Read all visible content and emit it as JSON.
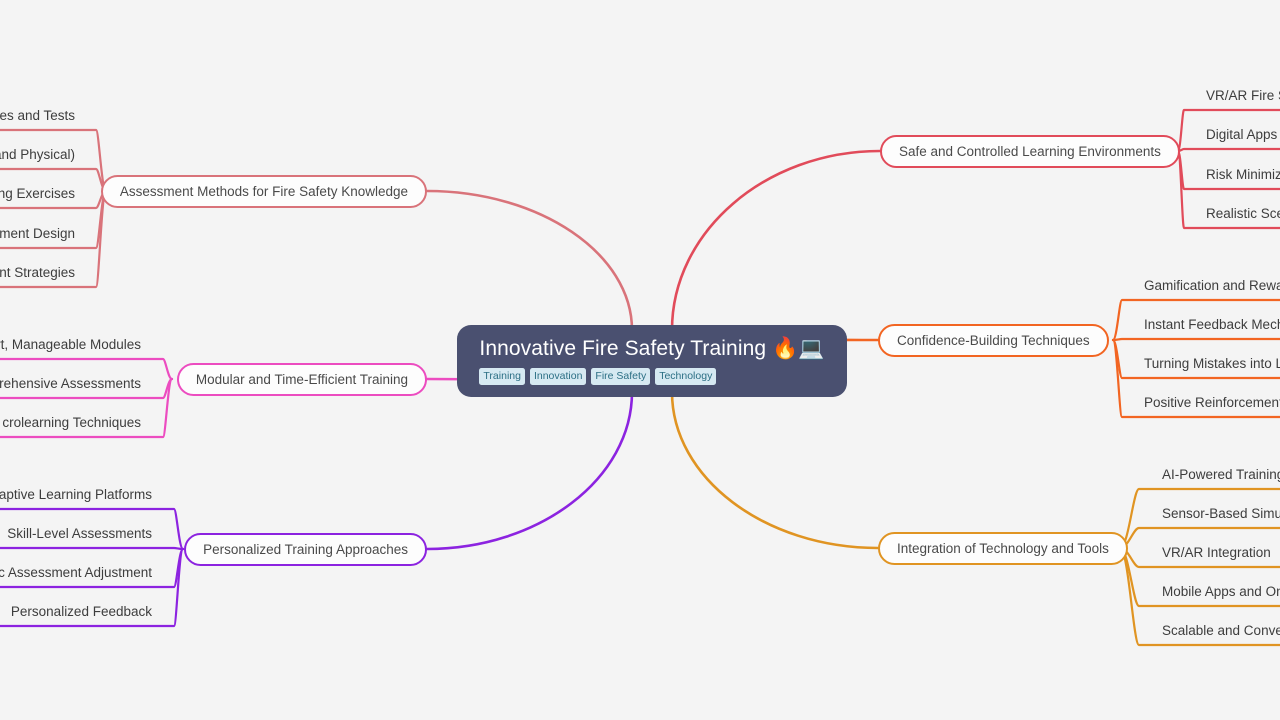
{
  "background_color": "#f4f4f4",
  "root": {
    "title": "Innovative Fire Safety Training 🔥💻",
    "title_text": "Innovative Fire Safety Training",
    "emoji_fire": "🔥",
    "emoji_laptop": "💻",
    "fill_color": "#4a5070",
    "text_color": "#ffffff",
    "tag_bg": "#d6e9f2",
    "tag_fg": "#2c6f85",
    "tags": [
      {
        "label": "Training"
      },
      {
        "label": "Innovation"
      },
      {
        "label": "Fire Safety"
      },
      {
        "label": "Technology"
      }
    ]
  },
  "branches": [
    {
      "id": "safe-controlled-learning-environments",
      "label": "Safe and Controlled Learning Environments",
      "color": "#e14b5a",
      "side": "right",
      "leaves": [
        {
          "label": "VR/AR Fire S"
        },
        {
          "label": "Digital Apps"
        },
        {
          "label": "Risk Minimiz"
        },
        {
          "label": "Realistic Sce"
        }
      ]
    },
    {
      "id": "confidence-building-techniques",
      "label": "Confidence-Building Techniques",
      "color": "#f26522",
      "side": "right",
      "leaves": [
        {
          "label": "Gamification and Rewa"
        },
        {
          "label": "Instant Feedback Mech"
        },
        {
          "label": "Turning Mistakes into L"
        },
        {
          "label": "Positive Reinforcement"
        }
      ]
    },
    {
      "id": "integration-of-technology-and-tools",
      "label": "Integration of Technology and Tools",
      "color": "#e09422",
      "side": "right",
      "leaves": [
        {
          "label": "AI-Powered Training"
        },
        {
          "label": "Sensor-Based Simu"
        },
        {
          "label": "VR/AR Integration"
        },
        {
          "label": "Mobile Apps and On"
        },
        {
          "label": "Scalable and Conve"
        }
      ]
    },
    {
      "id": "assessment-methods-for-fire-safety-knowledge",
      "label": "Assessment Methods for Fire Safety Knowledge",
      "color": "#d9737a",
      "side": "left",
      "leaves": [
        {
          "label": "zes and Tests"
        },
        {
          "label": "and Physical)"
        },
        {
          "label": "ing Exercises"
        },
        {
          "label": "ment Design"
        },
        {
          "label": "nt Strategies"
        }
      ]
    },
    {
      "id": "modular-and-time-efficient-training",
      "label": "Modular and Time-Efficient Training",
      "color": "#ec4cc0",
      "side": "left",
      "leaves": [
        {
          "label": "rt, Manageable Modules"
        },
        {
          "label": "prehensive Assessments"
        },
        {
          "label": "crolearning Techniques"
        }
      ]
    },
    {
      "id": "personalized-training-approaches",
      "label": "Personalized Training Approaches",
      "color": "#8c23e0",
      "side": "left",
      "leaves": [
        {
          "label": "aptive Learning Platforms"
        },
        {
          "label": "Skill-Level Assessments"
        },
        {
          "label": "c Assessment Adjustment"
        },
        {
          "label": "Personalized Feedback"
        }
      ]
    }
  ]
}
